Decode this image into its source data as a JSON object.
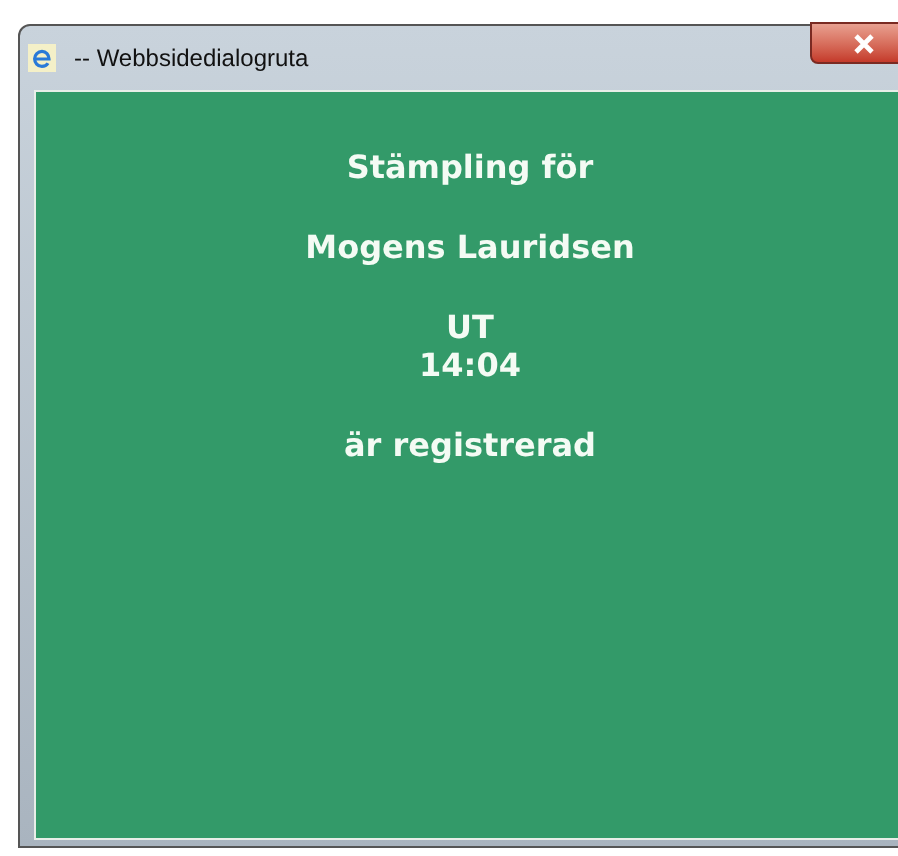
{
  "window": {
    "title": "-- Webbsidedialogruta"
  },
  "message": {
    "paragraphs": [
      {
        "lines": [
          "Stämpling för"
        ]
      },
      {
        "lines": [
          "Mogens Lauridsen"
        ]
      },
      {
        "lines": [
          "UT",
          "14:04"
        ]
      },
      {
        "lines": [
          "är registrerad"
        ]
      }
    ]
  }
}
